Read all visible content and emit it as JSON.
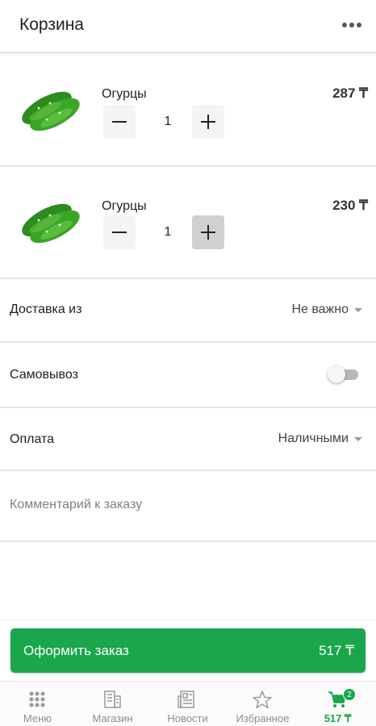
{
  "header": {
    "title": "Корзина"
  },
  "items": [
    {
      "name": "Огурцы",
      "price": "287 ₸",
      "qty": "1"
    },
    {
      "name": "Огурцы",
      "price": "230 ₸",
      "qty": "1"
    }
  ],
  "delivery": {
    "label": "Доставка из",
    "value": "Не важно"
  },
  "pickup": {
    "label": "Самовывоз",
    "enabled": false
  },
  "payment": {
    "label": "Оплата",
    "value": "Наличными"
  },
  "comment": {
    "placeholder": "Комментарий к заказу",
    "value": ""
  },
  "checkout": {
    "label": "Оформить заказ",
    "total": "517 ₸"
  },
  "tabs": [
    {
      "label": "Меню",
      "icon": "grid-icon"
    },
    {
      "label": "Магазин",
      "icon": "building-icon"
    },
    {
      "label": "Новости",
      "icon": "newspaper-icon"
    },
    {
      "label": "Избранное",
      "icon": "star-icon"
    },
    {
      "label": "517 ₸",
      "icon": "cart-icon",
      "badge": "2",
      "active": true
    }
  ],
  "colors": {
    "accent": "#1aa64a",
    "divider": "#e6e6e6",
    "pressed": "#d0d0d0"
  }
}
